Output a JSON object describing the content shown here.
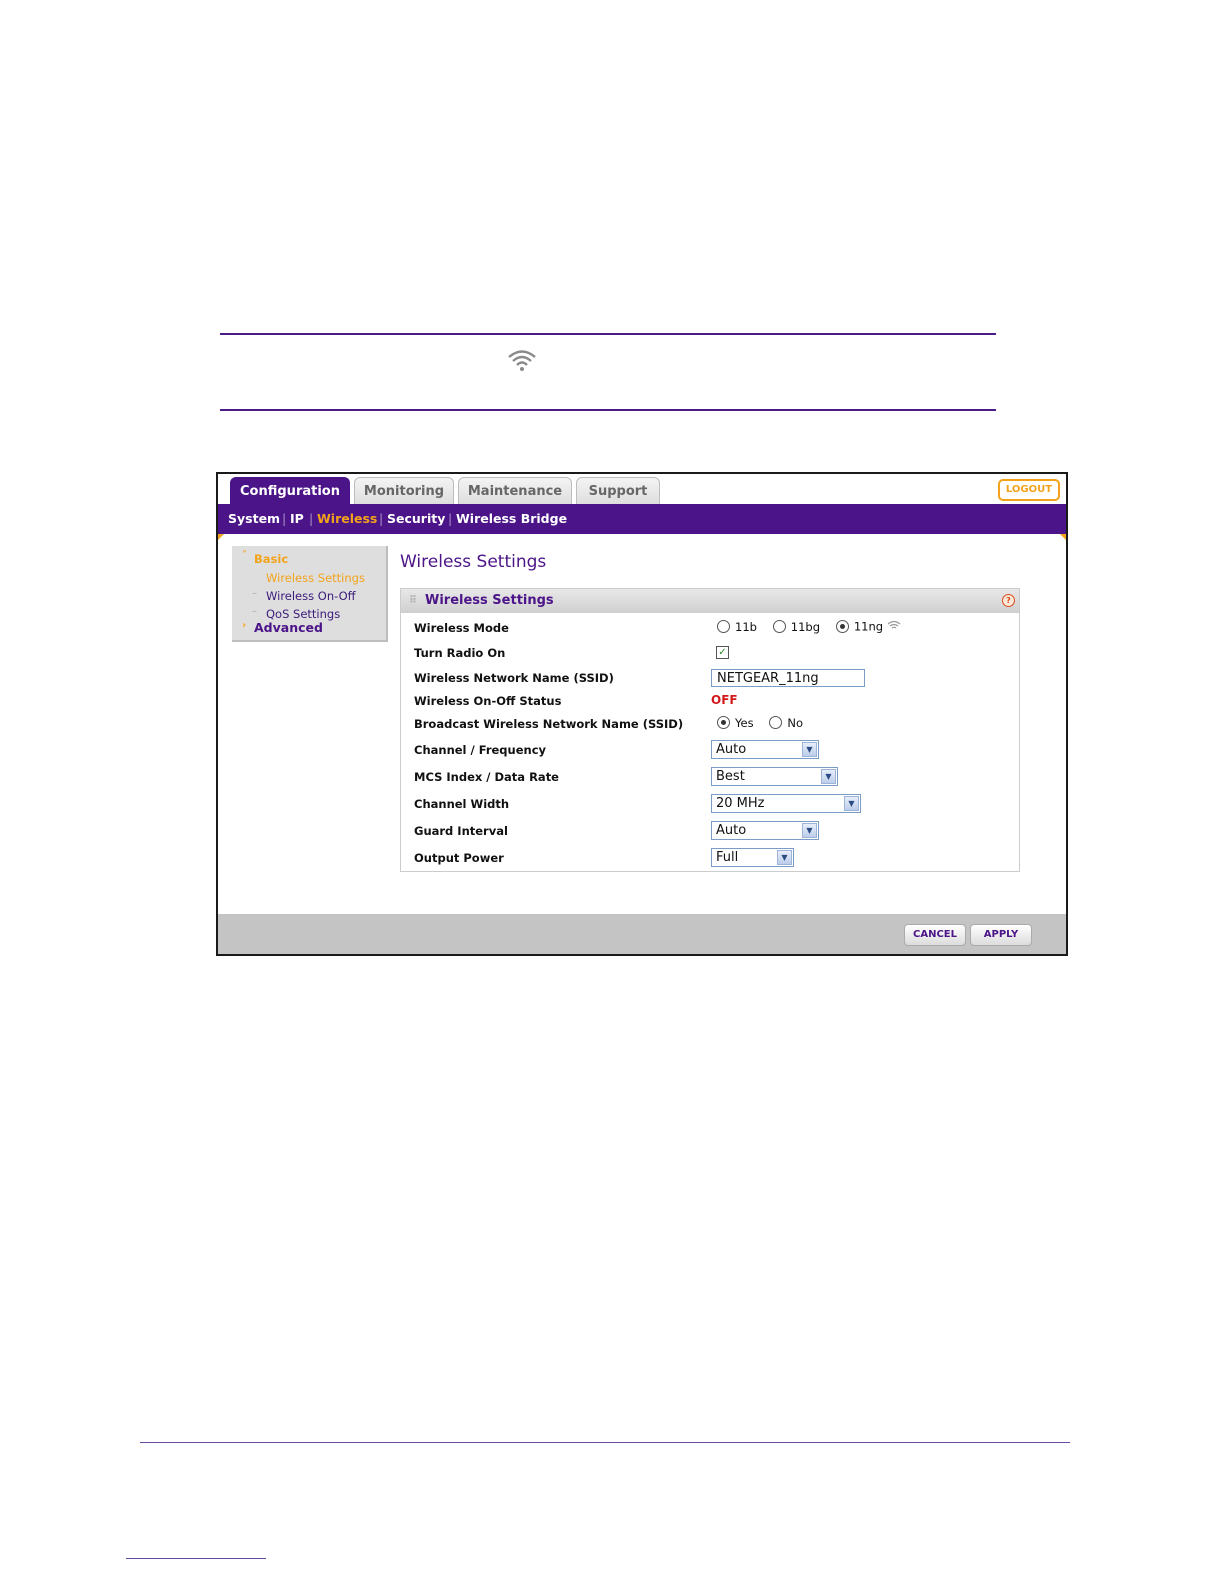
{
  "tabs": [
    "Configuration",
    "Monitoring",
    "Maintenance",
    "Support"
  ],
  "logout": "LOGOUT",
  "subnav": [
    "System",
    "IP",
    "Wireless",
    "Security",
    "Wireless Bridge"
  ],
  "sidebar": {
    "basic": "Basic",
    "items": [
      "Wireless Settings",
      "Wireless On-Off",
      "QoS Settings"
    ],
    "advanced": "Advanced"
  },
  "page_title": "Wireless Settings",
  "panel_title": "Wireless Settings",
  "form": {
    "wireless_mode": {
      "label": "Wireless Mode",
      "options": [
        "11b",
        "11bg",
        "11ng"
      ],
      "selected": "11ng"
    },
    "turn_radio_on": {
      "label": "Turn Radio On",
      "checked": true
    },
    "ssid": {
      "label": "Wireless Network Name (SSID)",
      "value": "NETGEAR_11ng"
    },
    "onoff_status": {
      "label": "Wireless On-Off Status",
      "value": "OFF"
    },
    "broadcast_ssid": {
      "label": "Broadcast Wireless Network Name (SSID)",
      "options": [
        "Yes",
        "No"
      ],
      "selected": "Yes"
    },
    "channel": {
      "label": "Channel / Frequency",
      "value": "Auto"
    },
    "mcs": {
      "label": "MCS Index / Data Rate",
      "value": "Best"
    },
    "channel_width": {
      "label": "Channel Width",
      "value": "20 MHz"
    },
    "guard_interval": {
      "label": "Guard Interval",
      "value": "Auto"
    },
    "output_power": {
      "label": "Output Power",
      "value": "Full"
    }
  },
  "buttons": {
    "cancel": "CANCEL",
    "apply": "APPLY"
  },
  "colors": {
    "brand_purple": "#4b1488",
    "accent_orange": "#f3a31b",
    "status_red": "#d21a1a"
  },
  "icons": [
    "wifi-icon",
    "help-icon",
    "chevron-down-icon",
    "checkmark-icon"
  ]
}
